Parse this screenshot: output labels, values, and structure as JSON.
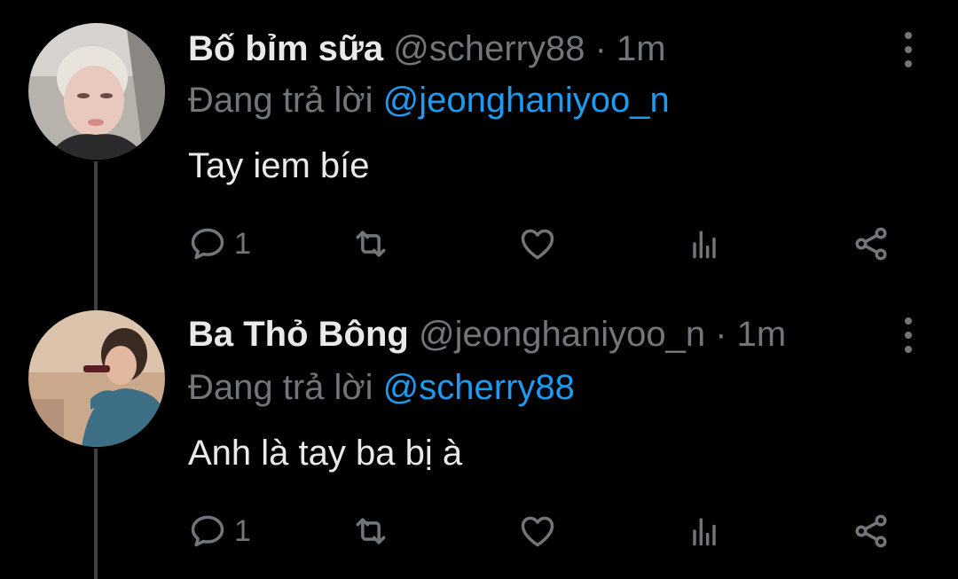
{
  "colors": {
    "background": "#000000",
    "primary_text": "#e7e9ea",
    "secondary_text": "#71767b",
    "link": "#1d9bf0",
    "thread_line": "#3e4144"
  },
  "tweets": [
    {
      "display_name": "Bố bỉm sữa",
      "handle": "@scherry88",
      "separator": "·",
      "time": "1m",
      "reply_prefix": "Đang trả lời",
      "reply_to": "@jeonghaniyoo_n",
      "text": "Tay iem bíe",
      "reply_count": "1",
      "icons": [
        "more-vertical-icon",
        "reply-icon",
        "retweet-icon",
        "like-icon",
        "stats-icon",
        "share-icon"
      ]
    },
    {
      "display_name": "Ba Thỏ Bông",
      "handle": "@jeonghaniyoo_n",
      "separator": "·",
      "time": "1m",
      "reply_prefix": "Đang trả lời",
      "reply_to": "@scherry88",
      "text": "Anh là tay ba bị à",
      "reply_count": "1",
      "icons": [
        "more-vertical-icon",
        "reply-icon",
        "retweet-icon",
        "like-icon",
        "stats-icon",
        "share-icon"
      ]
    }
  ]
}
